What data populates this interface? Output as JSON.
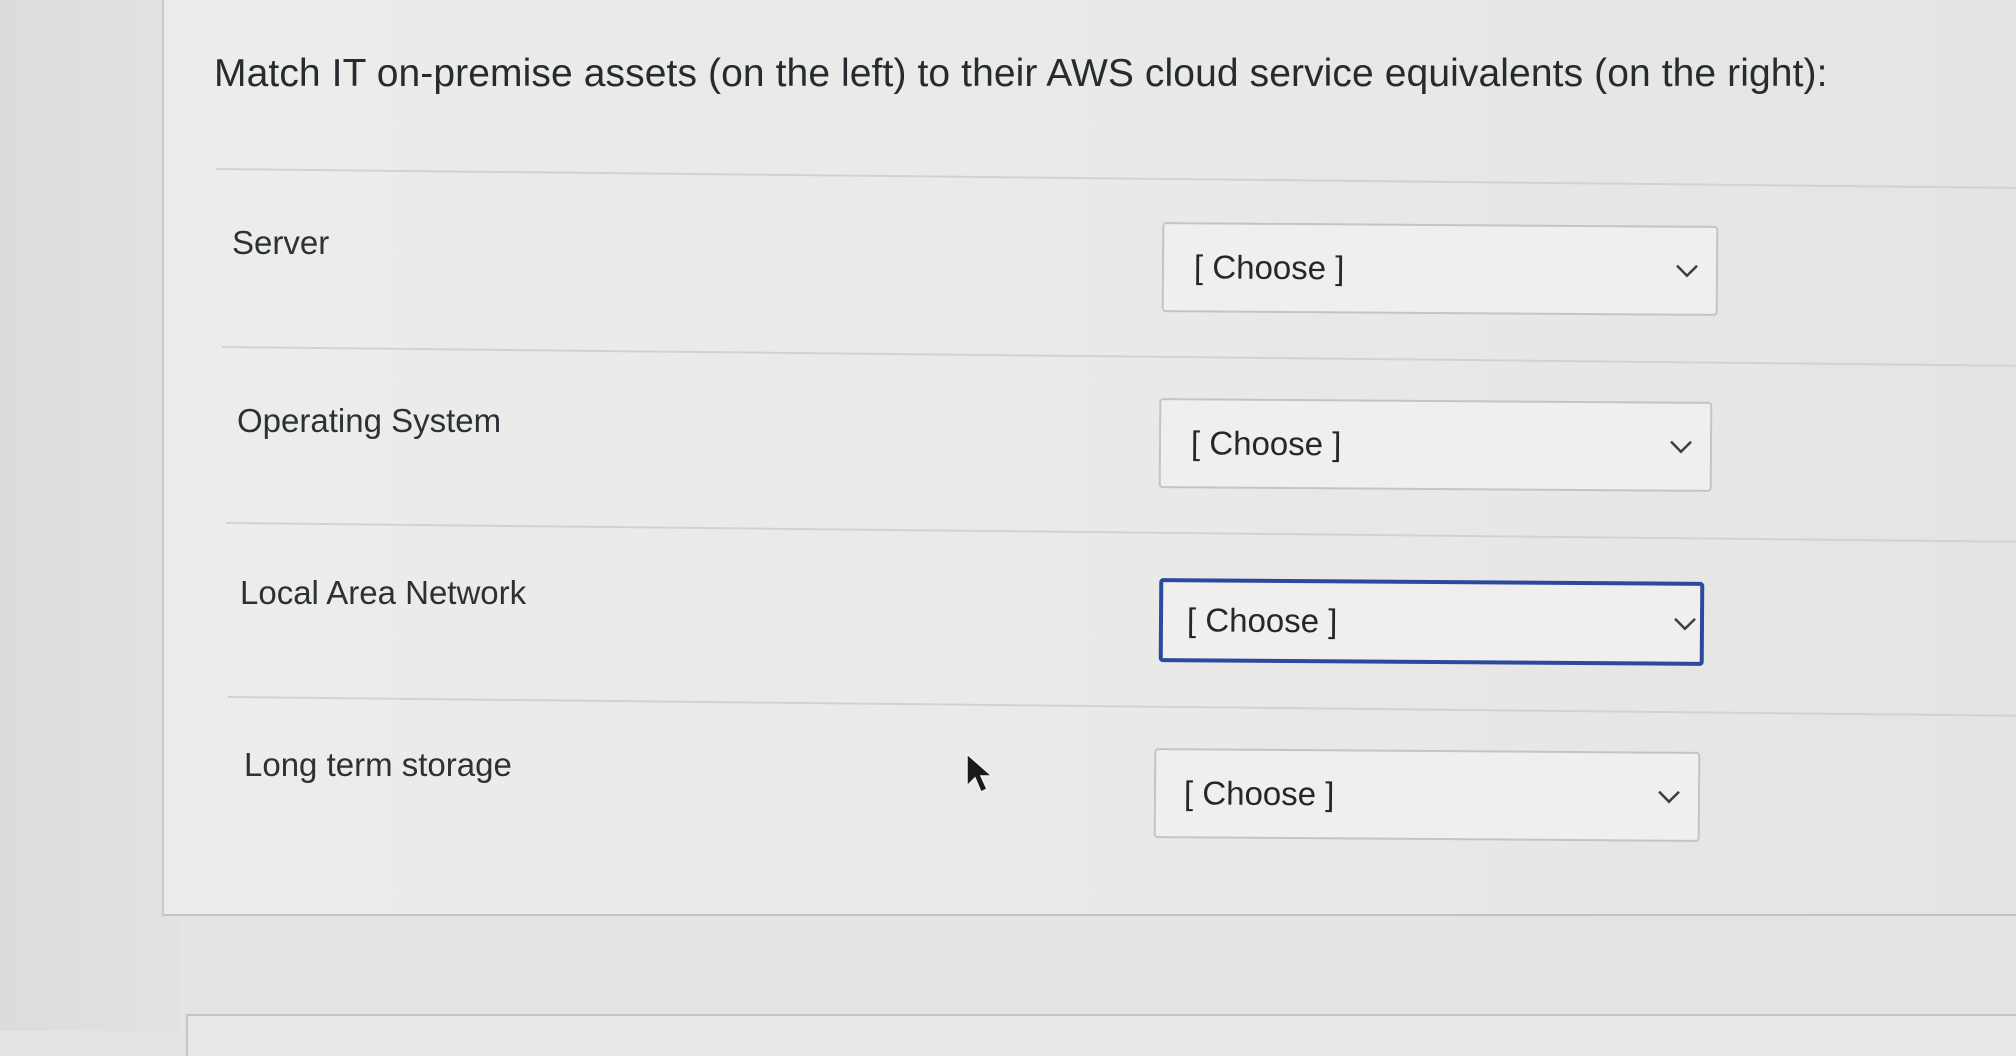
{
  "question": {
    "prompt": "Match IT on-premise assets (on the left) to their AWS cloud service equivalents (on the right):"
  },
  "matches": [
    {
      "label": "Server",
      "selected": "[ Choose ]",
      "focused": false
    },
    {
      "label": "Operating System",
      "selected": "[ Choose ]",
      "focused": false
    },
    {
      "label": "Local Area Network",
      "selected": "[ Choose ]",
      "focused": true
    },
    {
      "label": "Long term storage",
      "selected": "[ Choose ]",
      "focused": false
    }
  ],
  "icons": {
    "dropdown": "chevron-down-icon",
    "cursor": "mouse-pointer-icon"
  },
  "colors": {
    "focus_border": "#2b4a9e",
    "text": "#262b30",
    "background": "#ecedeb"
  }
}
